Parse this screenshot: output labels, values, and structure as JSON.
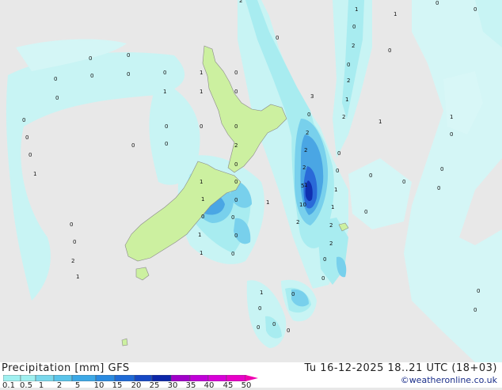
{
  "legend": {
    "title": "Precipitation [mm]  GFS",
    "datetime": "Tu 16-12-2025 18..21 UTC (18+03)",
    "credit": "©weatheronline.co.uk",
    "scale_labels": [
      "0.1",
      "0.5",
      "1",
      "2",
      "5",
      "10",
      "15",
      "20",
      "25",
      "30",
      "35",
      "40",
      "45",
      "50"
    ],
    "scale_colors": [
      "#a0f0f0",
      "#a0f0f0",
      "#7ad8ec",
      "#5ac4ea",
      "#3ca8e6",
      "#2a8ae0",
      "#1f6ad6",
      "#1648c4",
      "#0c26a8",
      "#a000c8",
      "#c000d8",
      "#d800d8",
      "#e800c8",
      "#f000b0"
    ]
  },
  "map": {
    "colors": {
      "sea": "#e8e8e8",
      "land": "#ccf0a0",
      "precip_light": "#c8f4f4",
      "precip_1": "#a8ecf0",
      "precip_2": "#78d0ec",
      "precip_5": "#4aa6e4",
      "precip_10": "#2a6ad8",
      "precip_heavy": "#1030b0"
    },
    "values": [
      "2",
      "1",
      "0",
      "1",
      "0",
      "0",
      "0",
      "0",
      "0",
      "0",
      "0",
      "0",
      "0",
      "0",
      "1",
      "2",
      "0",
      "0",
      "1",
      "1",
      "0",
      "0",
      "2",
      "1",
      "0",
      "3",
      "1",
      "0",
      "0",
      "0",
      "0",
      "0",
      "2",
      "1",
      "0",
      "2",
      "0",
      "0",
      "2",
      "0",
      "0",
      "1",
      "2",
      "0",
      "0",
      "0",
      "2",
      "1",
      "5",
      "1",
      "0",
      "0",
      "1",
      "0",
      "10",
      "1",
      "0",
      "0",
      "0",
      "0",
      "2",
      "2",
      "1",
      "0",
      "2",
      "1",
      "0",
      "0",
      "0",
      "0",
      "1",
      "2",
      "1",
      "0",
      "0",
      "1",
      "1",
      "0",
      "0",
      "0",
      "0",
      "0",
      "0",
      "0"
    ]
  }
}
